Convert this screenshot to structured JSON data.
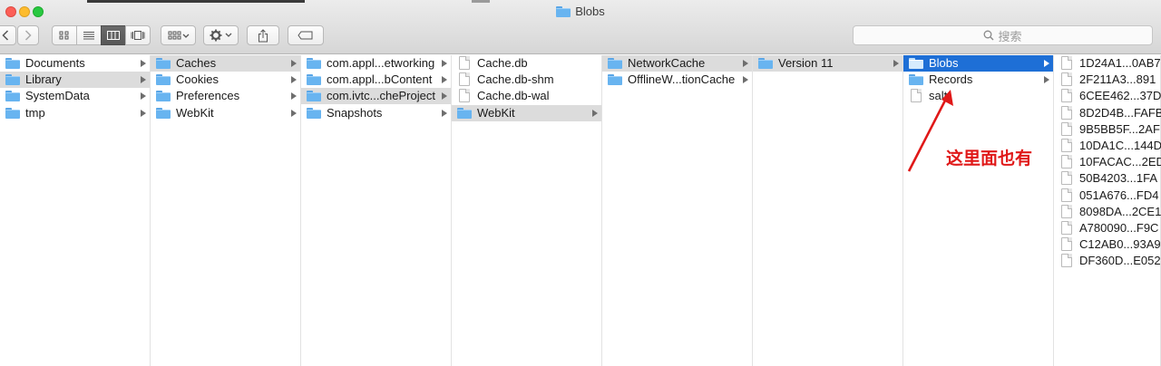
{
  "window": {
    "title": "Blobs",
    "search_placeholder": "搜索",
    "toolbar_icons": [
      "back-icon",
      "forward-icon",
      "icon-view-icon",
      "list-view-icon",
      "column-view-icon",
      "cover-flow-icon",
      "arrange-icon",
      "action-gear-icon",
      "share-icon",
      "tag-icon"
    ]
  },
  "columns": [
    {
      "items": [
        {
          "label": "Documents",
          "kind": "folder",
          "state": "normal"
        },
        {
          "label": "Library",
          "kind": "folder",
          "state": "gray"
        },
        {
          "label": "SystemData",
          "kind": "folder",
          "state": "normal"
        },
        {
          "label": "tmp",
          "kind": "folder",
          "state": "normal"
        }
      ]
    },
    {
      "items": [
        {
          "label": "Caches",
          "kind": "folder",
          "state": "gray"
        },
        {
          "label": "Cookies",
          "kind": "folder",
          "state": "normal"
        },
        {
          "label": "Preferences",
          "kind": "folder",
          "state": "normal"
        },
        {
          "label": "WebKit",
          "kind": "folder",
          "state": "normal"
        }
      ]
    },
    {
      "items": [
        {
          "label": "com.appl...etworking",
          "kind": "folder",
          "state": "normal"
        },
        {
          "label": "com.appl...bContent",
          "kind": "folder",
          "state": "normal"
        },
        {
          "label": "com.ivtc...cheProject",
          "kind": "folder",
          "state": "gray"
        },
        {
          "label": "Snapshots",
          "kind": "folder",
          "state": "normal"
        }
      ]
    },
    {
      "items": [
        {
          "label": "Cache.db",
          "kind": "file",
          "state": "normal"
        },
        {
          "label": "Cache.db-shm",
          "kind": "file",
          "state": "normal"
        },
        {
          "label": "Cache.db-wal",
          "kind": "file",
          "state": "normal"
        },
        {
          "label": "WebKit",
          "kind": "folder",
          "state": "gray"
        }
      ]
    },
    {
      "items": [
        {
          "label": "NetworkCache",
          "kind": "folder",
          "state": "gray"
        },
        {
          "label": "OfflineW...tionCache",
          "kind": "folder",
          "state": "normal"
        }
      ]
    },
    {
      "items": [
        {
          "label": "Version 11",
          "kind": "folder",
          "state": "gray"
        }
      ]
    },
    {
      "items": [
        {
          "label": "Blobs",
          "kind": "folder",
          "state": "blue"
        },
        {
          "label": "Records",
          "kind": "folder",
          "state": "normal"
        },
        {
          "label": "salt",
          "kind": "file",
          "state": "normal"
        }
      ]
    },
    {
      "items": [
        {
          "label": "1D24A1...0AB7",
          "kind": "file",
          "state": "normal"
        },
        {
          "label": "2F211A3...891",
          "kind": "file",
          "state": "normal"
        },
        {
          "label": "6CEE462...37D",
          "kind": "file",
          "state": "normal"
        },
        {
          "label": "8D2D4B...FAFB",
          "kind": "file",
          "state": "normal"
        },
        {
          "label": "9B5BB5F...2AF",
          "kind": "file",
          "state": "normal"
        },
        {
          "label": "10DA1C...144D",
          "kind": "file",
          "state": "normal"
        },
        {
          "label": "10FACAC...2ED",
          "kind": "file",
          "state": "normal"
        },
        {
          "label": "50B4203...1FA",
          "kind": "file",
          "state": "normal"
        },
        {
          "label": "051A676...FD4",
          "kind": "file",
          "state": "normal"
        },
        {
          "label": "8098DA...2CE1",
          "kind": "file",
          "state": "normal"
        },
        {
          "label": "A780090...F9C",
          "kind": "file",
          "state": "normal"
        },
        {
          "label": "C12AB0...93A9",
          "kind": "file",
          "state": "normal"
        },
        {
          "label": "DF360D...E052",
          "kind": "file",
          "state": "normal"
        }
      ]
    }
  ],
  "annotation": {
    "text": "这里面也有",
    "color": "#e01818"
  },
  "colors": {
    "selection_blue": "#1e6fd6",
    "selection_gray": "#dcdcdc",
    "folder_blue": "#68b4f0"
  }
}
